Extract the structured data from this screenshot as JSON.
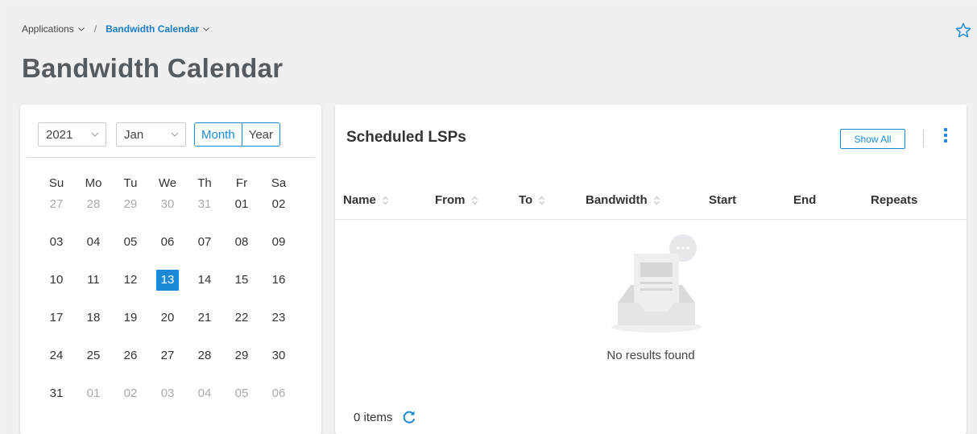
{
  "breadcrumb": {
    "parent": "Applications",
    "current": "Bandwidth Calendar"
  },
  "page_title": "Bandwidth Calendar",
  "calendar": {
    "year": "2021",
    "month": "Jan",
    "view_month": "Month",
    "view_year": "Year",
    "weekdays": [
      "Su",
      "Mo",
      "Tu",
      "We",
      "Th",
      "Fr",
      "Sa"
    ],
    "weeks": [
      [
        "27",
        "28",
        "29",
        "30",
        "31",
        "01",
        "02"
      ],
      [
        "03",
        "04",
        "05",
        "06",
        "07",
        "08",
        "09"
      ],
      [
        "10",
        "11",
        "12",
        "13",
        "14",
        "15",
        "16"
      ],
      [
        "17",
        "18",
        "19",
        "20",
        "21",
        "22",
        "23"
      ],
      [
        "24",
        "25",
        "26",
        "27",
        "28",
        "29",
        "30"
      ],
      [
        "31",
        "01",
        "02",
        "03",
        "04",
        "05",
        "06"
      ]
    ],
    "selected": "13"
  },
  "lsp": {
    "title": "Scheduled LSPs",
    "show_all": "Show All",
    "columns": {
      "name": "Name",
      "from": "From",
      "to": "To",
      "bandwidth": "Bandwidth",
      "start": "Start",
      "end": "End",
      "repeats": "Repeats"
    },
    "empty_message": "No results found",
    "items_count": "0 items"
  },
  "colors": {
    "accent": "#1a8ad8",
    "title": "#555b61"
  }
}
